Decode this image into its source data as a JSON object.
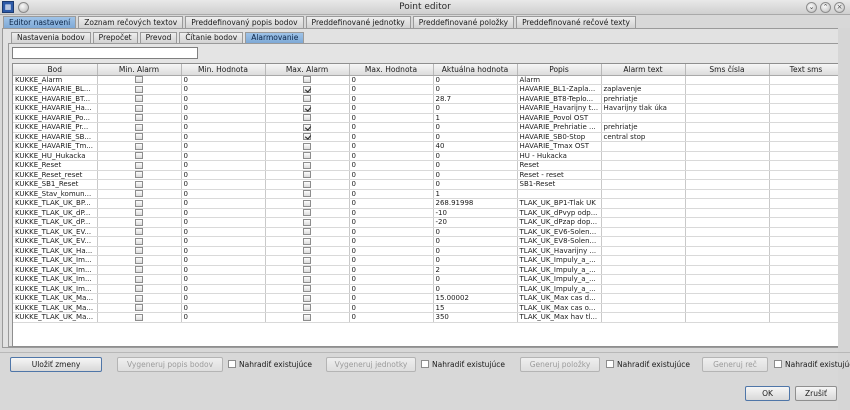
{
  "window": {
    "title": "Point editor"
  },
  "main_tabs": [
    "Editor nastavení",
    "Zoznam rečových textov",
    "Preddefinovaný popis bodov",
    "Preddefinované jednotky",
    "Preddefinované položky",
    "Preddefinované rečové texty"
  ],
  "sub_tabs": [
    "Nastavenia bodov",
    "Prepočet",
    "Prevod",
    "Čítanie bodov",
    "Alarmovanie"
  ],
  "filter": {
    "value": ""
  },
  "columns": [
    "Bod",
    "Min. Alarm",
    "Min. Hodnota",
    "Max. Alarm",
    "Max. Hodnota",
    "Aktuálna hodnota",
    "Popis",
    "Alarm text",
    "Sms čísla",
    "Text sms"
  ],
  "rows": [
    {
      "bod": "KUKKE_Alarm",
      "min_alarm": false,
      "min_hodnota": "0",
      "max_alarm": false,
      "max_hodnota": "0",
      "aktualna": "0",
      "popis": "Alarm",
      "alarm_text": "",
      "sms": "",
      "text_sms": ""
    },
    {
      "bod": "KUKKE_HAVARIE_BL...",
      "min_alarm": false,
      "min_hodnota": "0",
      "max_alarm": true,
      "max_hodnota": "0",
      "aktualna": "0",
      "popis": "HAVARIE_BL1-Zapla...",
      "alarm_text": "zaplavenje",
      "sms": "",
      "text_sms": ""
    },
    {
      "bod": "KUKKE_HAVARIE_BT...",
      "min_alarm": false,
      "min_hodnota": "0",
      "max_alarm": false,
      "max_hodnota": "0",
      "aktualna": "28.7",
      "popis": "HAVARIE_BT8-Teplo...",
      "alarm_text": "prehriatje",
      "sms": "",
      "text_sms": ""
    },
    {
      "bod": "KUKKE_HAVARIE_Ha...",
      "min_alarm": false,
      "min_hodnota": "0",
      "max_alarm": true,
      "max_hodnota": "0",
      "aktualna": "0",
      "popis": "HAVARIE_Havarijny t...",
      "alarm_text": "Havarijny tlak úka",
      "sms": "",
      "text_sms": ""
    },
    {
      "bod": "KUKKE_HAVARIE_Po...",
      "min_alarm": false,
      "min_hodnota": "0",
      "max_alarm": false,
      "max_hodnota": "0",
      "aktualna": "1",
      "popis": "HAVARIE_Povol OST",
      "alarm_text": "",
      "sms": "",
      "text_sms": ""
    },
    {
      "bod": "KUKKE_HAVARIE_Pr...",
      "min_alarm": false,
      "min_hodnota": "0",
      "max_alarm": true,
      "max_hodnota": "0",
      "aktualna": "0",
      "popis": "HAVARIE_Prehriatie ...",
      "alarm_text": "prehriatje",
      "sms": "",
      "text_sms": ""
    },
    {
      "bod": "KUKKE_HAVARIE_SB...",
      "min_alarm": false,
      "min_hodnota": "0",
      "max_alarm": true,
      "max_hodnota": "0",
      "aktualna": "0",
      "popis": "HAVARIE_SB0-Stop",
      "alarm_text": "central stop",
      "sms": "",
      "text_sms": ""
    },
    {
      "bod": "KUKKE_HAVARIE_Tm...",
      "min_alarm": false,
      "min_hodnota": "0",
      "max_alarm": false,
      "max_hodnota": "0",
      "aktualna": "40",
      "popis": "HAVARIE_Tmax OST",
      "alarm_text": "",
      "sms": "",
      "text_sms": ""
    },
    {
      "bod": "KUKKE_HU_Hukacka",
      "min_alarm": false,
      "min_hodnota": "0",
      "max_alarm": false,
      "max_hodnota": "0",
      "aktualna": "0",
      "popis": "HU - Hukacka",
      "alarm_text": "",
      "sms": "",
      "text_sms": ""
    },
    {
      "bod": "KUKKE_Reset",
      "min_alarm": false,
      "min_hodnota": "0",
      "max_alarm": false,
      "max_hodnota": "0",
      "aktualna": "0",
      "popis": "Reset",
      "alarm_text": "",
      "sms": "",
      "text_sms": ""
    },
    {
      "bod": "KUKKE_Reset_reset",
      "min_alarm": false,
      "min_hodnota": "0",
      "max_alarm": false,
      "max_hodnota": "0",
      "aktualna": "0",
      "popis": "Reset - reset",
      "alarm_text": "",
      "sms": "",
      "text_sms": ""
    },
    {
      "bod": "KUKKE_SB1_Reset",
      "min_alarm": false,
      "min_hodnota": "0",
      "max_alarm": false,
      "max_hodnota": "0",
      "aktualna": "0",
      "popis": "SB1-Reset",
      "alarm_text": "",
      "sms": "",
      "text_sms": ""
    },
    {
      "bod": "KUKKE_Stav_komun...",
      "min_alarm": false,
      "min_hodnota": "0",
      "max_alarm": false,
      "max_hodnota": "0",
      "aktualna": "1",
      "popis": "",
      "alarm_text": "",
      "sms": "",
      "text_sms": ""
    },
    {
      "bod": "KUKKE_TLAK_UK_BP...",
      "min_alarm": false,
      "min_hodnota": "0",
      "max_alarm": false,
      "max_hodnota": "0",
      "aktualna": "268.91998",
      "popis": "TLAK_UK_BP1-Tlak UK",
      "alarm_text": "",
      "sms": "",
      "text_sms": ""
    },
    {
      "bod": "KUKKE_TLAK_UK_dP...",
      "min_alarm": false,
      "min_hodnota": "0",
      "max_alarm": false,
      "max_hodnota": "0",
      "aktualna": "-10",
      "popis": "TLAK_UK_dPvyp odp...",
      "alarm_text": "",
      "sms": "",
      "text_sms": ""
    },
    {
      "bod": "KUKKE_TLAK_UK_dP...",
      "min_alarm": false,
      "min_hodnota": "0",
      "max_alarm": false,
      "max_hodnota": "0",
      "aktualna": "-20",
      "popis": "TLAK_UK_dPzap dop...",
      "alarm_text": "",
      "sms": "",
      "text_sms": ""
    },
    {
      "bod": "KUKKE_TLAK_UK_EV...",
      "min_alarm": false,
      "min_hodnota": "0",
      "max_alarm": false,
      "max_hodnota": "0",
      "aktualna": "0",
      "popis": "TLAK_UK_EV6-Solen...",
      "alarm_text": "",
      "sms": "",
      "text_sms": ""
    },
    {
      "bod": "KUKKE_TLAK_UK_EV...",
      "min_alarm": false,
      "min_hodnota": "0",
      "max_alarm": false,
      "max_hodnota": "0",
      "aktualna": "0",
      "popis": "TLAK_UK_EV8-Solen...",
      "alarm_text": "",
      "sms": "",
      "text_sms": ""
    },
    {
      "bod": "KUKKE_TLAK_UK_Ha...",
      "min_alarm": false,
      "min_hodnota": "0",
      "max_alarm": false,
      "max_hodnota": "0",
      "aktualna": "0",
      "popis": "TLAK_UK_Havarijny ...",
      "alarm_text": "",
      "sms": "",
      "text_sms": ""
    },
    {
      "bod": "KUKKE_TLAK_UK_Im...",
      "min_alarm": false,
      "min_hodnota": "0",
      "max_alarm": false,
      "max_hodnota": "0",
      "aktualna": "0",
      "popis": "TLAK_UK_Impuly_a_...",
      "alarm_text": "",
      "sms": "",
      "text_sms": ""
    },
    {
      "bod": "KUKKE_TLAK_UK_Im...",
      "min_alarm": false,
      "min_hodnota": "0",
      "max_alarm": false,
      "max_hodnota": "0",
      "aktualna": "2",
      "popis": "TLAK_UK_Impuly_a_...",
      "alarm_text": "",
      "sms": "",
      "text_sms": ""
    },
    {
      "bod": "KUKKE_TLAK_UK_Im...",
      "min_alarm": false,
      "min_hodnota": "0",
      "max_alarm": false,
      "max_hodnota": "0",
      "aktualna": "0",
      "popis": "TLAK_UK_Impuly_a_...",
      "alarm_text": "",
      "sms": "",
      "text_sms": ""
    },
    {
      "bod": "KUKKE_TLAK_UK_Im...",
      "min_alarm": false,
      "min_hodnota": "0",
      "max_alarm": false,
      "max_hodnota": "0",
      "aktualna": "0",
      "popis": "TLAK_UK_Impuly_a_...",
      "alarm_text": "",
      "sms": "",
      "text_sms": ""
    },
    {
      "bod": "KUKKE_TLAK_UK_Ma...",
      "min_alarm": false,
      "min_hodnota": "0",
      "max_alarm": false,
      "max_hodnota": "0",
      "aktualna": "15.00002",
      "popis": "TLAK_UK_Max cas d...",
      "alarm_text": "",
      "sms": "",
      "text_sms": ""
    },
    {
      "bod": "KUKKE_TLAK_UK_Ma...",
      "min_alarm": false,
      "min_hodnota": "0",
      "max_alarm": false,
      "max_hodnota": "0",
      "aktualna": "15",
      "popis": "TLAK_UK_Max cas o...",
      "alarm_text": "",
      "sms": "",
      "text_sms": ""
    },
    {
      "bod": "KUKKE_TLAK_UK_Ma...",
      "min_alarm": false,
      "min_hodnota": "0",
      "max_alarm": false,
      "max_hodnota": "0",
      "aktualna": "350",
      "popis": "TLAK_UK_Max hav tl...",
      "alarm_text": "",
      "sms": "",
      "text_sms": ""
    }
  ],
  "footer": {
    "save": "Uložiť zmeny",
    "gen_popis": "Vygeneruj popis bodov",
    "replace1": "Nahradiť existujúce",
    "gen_jednotky": "Vygeneruj jednotky",
    "replace2": "Nahradiť existujúce",
    "gen_polozky": "Generuj položky",
    "replace3": "Nahradiť existujúce",
    "gen_rec": "Generuj reč",
    "replace4": "Nahradiť existujúci",
    "ok": "OK",
    "cancel": "Zrušiť"
  },
  "icons": {
    "app": "app-icon",
    "minimize": "minimize-icon",
    "maximize": "maximize-icon",
    "close": "close-icon"
  }
}
